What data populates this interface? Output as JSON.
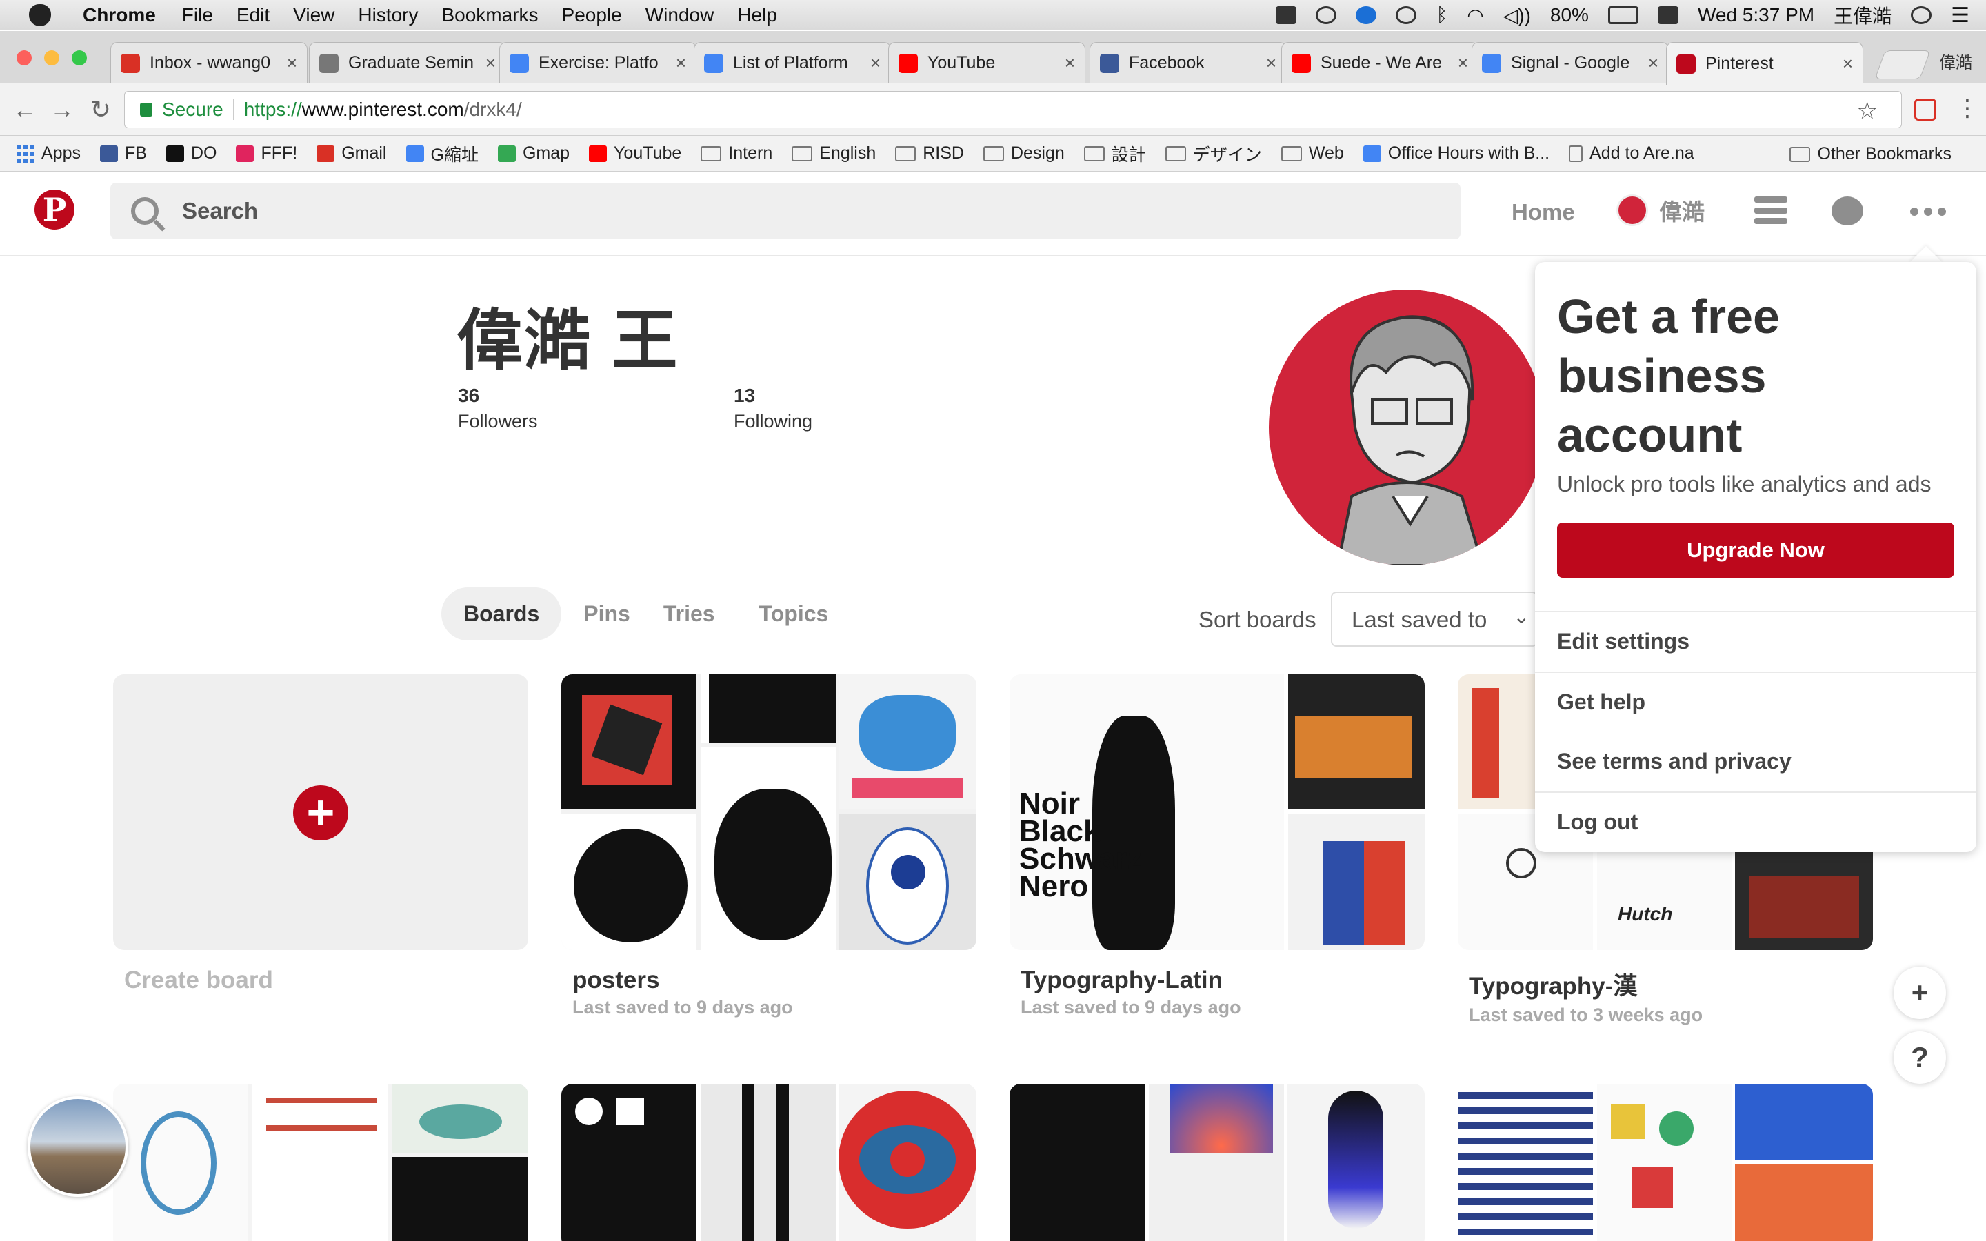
{
  "menubar": {
    "items": [
      "Chrome",
      "File",
      "Edit",
      "View",
      "History",
      "Bookmarks",
      "People",
      "Window",
      "Help"
    ],
    "battery": "80%",
    "clock": "Wed 5:37 PM",
    "user": "王偉澔"
  },
  "tabs": [
    {
      "title": "Inbox - wwang0",
      "icon": "gmail-icon",
      "color": "#d93025"
    },
    {
      "title": "Graduate Semin",
      "icon": "chat-bubble-icon",
      "color": "#777777"
    },
    {
      "title": "Exercise: Platfo",
      "icon": "docs-icon",
      "color": "#4285f4"
    },
    {
      "title": "List of Platform",
      "icon": "docs-icon",
      "color": "#4285f4"
    },
    {
      "title": "YouTube",
      "icon": "youtube-icon",
      "color": "#ff0000"
    },
    {
      "title": "Facebook",
      "icon": "facebook-icon",
      "color": "#3b5998"
    },
    {
      "title": "Suede - We Are",
      "icon": "youtube-icon",
      "color": "#ff0000"
    },
    {
      "title": "Signal - Google",
      "icon": "google-icon",
      "color": "#4285f4"
    },
    {
      "title": "Pinterest",
      "icon": "pinterest-icon",
      "color": "#bd081c"
    }
  ],
  "profile_badge": "偉澔",
  "toolbar": {
    "secure": "Secure",
    "url_scheme": "https://",
    "url_host": "www.pinterest.com",
    "url_path": "/drxk4/"
  },
  "bookmarks": {
    "items": [
      {
        "label": "Apps",
        "type": "apps"
      },
      {
        "label": "FB",
        "type": "site",
        "color": "#3b5998"
      },
      {
        "label": "DO",
        "type": "site",
        "color": "#111111"
      },
      {
        "label": "FFF!",
        "type": "site",
        "color": "#e0245e"
      },
      {
        "label": "Gmail",
        "type": "site",
        "color": "#d93025"
      },
      {
        "label": "G縮址",
        "type": "site",
        "color": "#4285f4"
      },
      {
        "label": "Gmap",
        "type": "site",
        "color": "#34a853"
      },
      {
        "label": "YouTube",
        "type": "site",
        "color": "#ff0000"
      },
      {
        "label": "Intern",
        "type": "folder"
      },
      {
        "label": "English",
        "type": "folder"
      },
      {
        "label": "RISD",
        "type": "folder"
      },
      {
        "label": "Design",
        "type": "folder"
      },
      {
        "label": "設計",
        "type": "folder"
      },
      {
        "label": "デザイン",
        "type": "folder"
      },
      {
        "label": "Web",
        "type": "folder"
      },
      {
        "label": "Office Hours with B...",
        "type": "site",
        "color": "#4285f4"
      },
      {
        "label": "Add to Are.na",
        "type": "page"
      }
    ],
    "other": "Other Bookmarks"
  },
  "pinterest": {
    "search_placeholder": "Search",
    "nav_home": "Home",
    "nav_user": "偉澔",
    "brand_color": "#bd081c"
  },
  "profile": {
    "name": "偉澔 王",
    "followers_count": "36",
    "followers_label": "Followers",
    "following_count": "13",
    "following_label": "Following"
  },
  "profile_tabs": [
    "Boards",
    "Pins",
    "Tries",
    "Topics"
  ],
  "sort": {
    "label": "Sort boards",
    "value": "Last saved to"
  },
  "boards": [
    {
      "title": "Create board",
      "subtitle": ""
    },
    {
      "title": "posters",
      "subtitle": "Last saved to 9 days ago"
    },
    {
      "title": "Typography-Latin",
      "subtitle": "Last saved to 9 days ago"
    },
    {
      "title": "Typography-漢",
      "subtitle": "Last saved to 3 weeks ago"
    }
  ],
  "cover_text": {
    "noir": [
      "Noir",
      "Black",
      "Schwarz",
      "Nero"
    ],
    "hatch": "Hutch"
  },
  "dropdown": {
    "title": "Get a free business account",
    "subtitle": "Unlock pro tools like analytics and ads",
    "button": "Upgrade Now",
    "items": [
      "Edit settings",
      "Get help",
      "See terms and privacy",
      "Log out"
    ]
  },
  "fab": {
    "plus": "+",
    "help": "?"
  }
}
